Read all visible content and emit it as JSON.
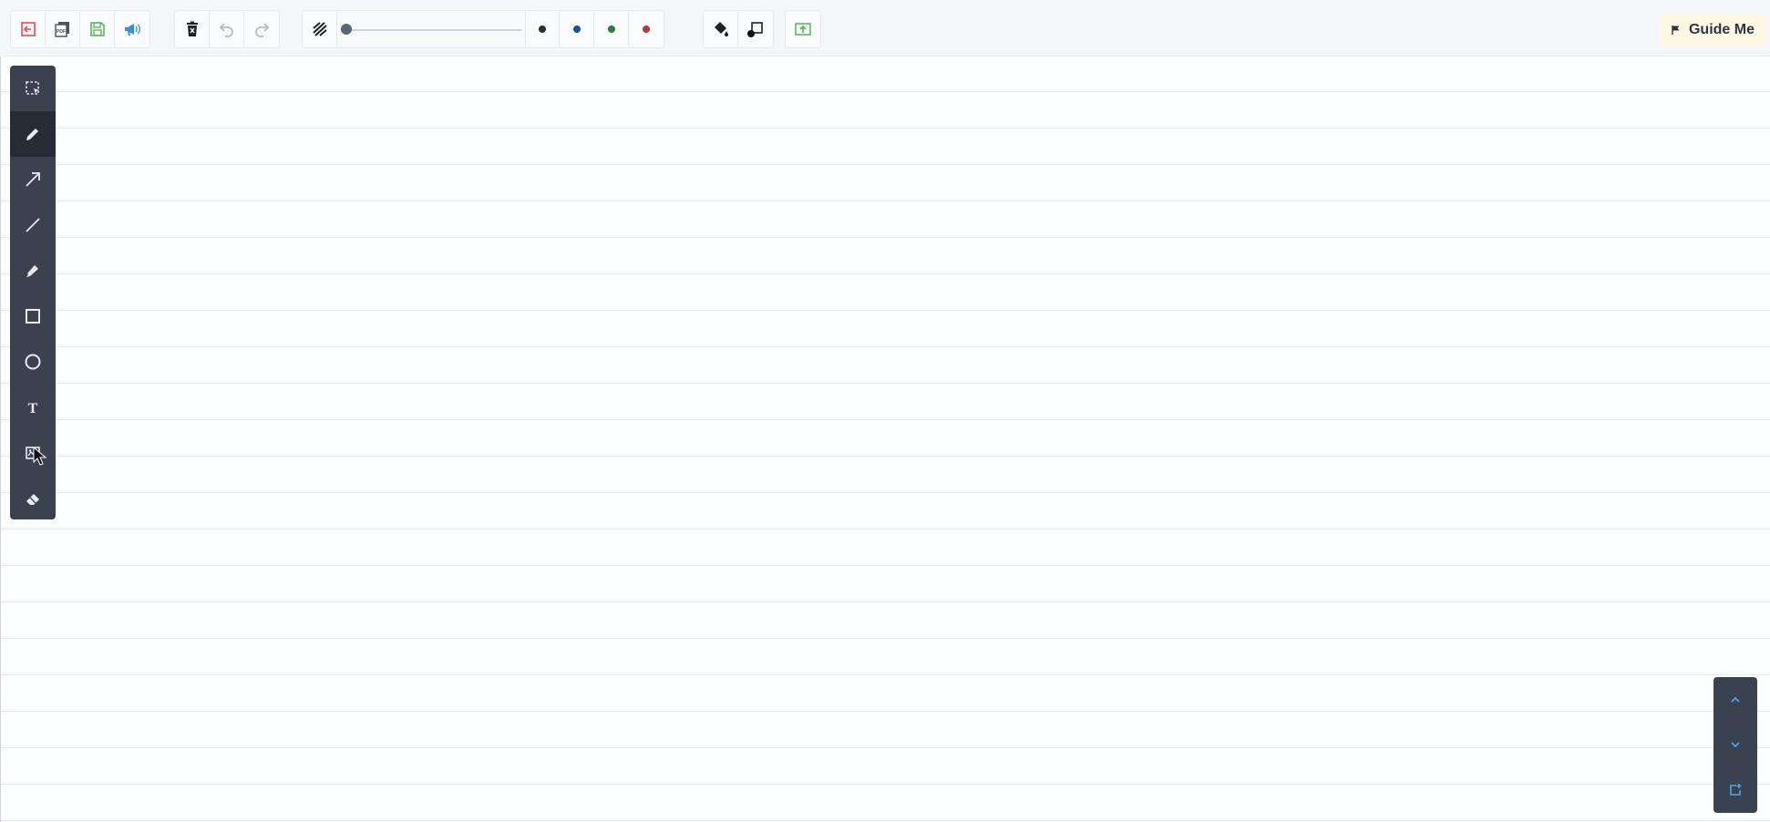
{
  "colors": {
    "toolbar_bg": "#f4f6f9",
    "sidebar_bg": "#3a4250",
    "sidebar_active": "#262c36",
    "accent_red": "#d9534f",
    "accent_green": "#5cb85c",
    "accent_blue": "#3b8fd9",
    "guide_bg": "#fdf8e4"
  },
  "toolbar": {
    "file_group": [
      "exit-icon",
      "pdf-icon",
      "save-icon",
      "megaphone-icon"
    ],
    "edit_group": [
      "delete-icon",
      "undo-icon",
      "redo-icon"
    ],
    "stroke_width_value": 0,
    "pen_colors": [
      {
        "name": "black",
        "hex": "#2d2d2d"
      },
      {
        "name": "blue",
        "hex": "#1f4f96"
      },
      {
        "name": "green",
        "hex": "#2e7d3c"
      },
      {
        "name": "red",
        "hex": "#b23a3a"
      }
    ],
    "fill_group": [
      "fill-bucket-icon",
      "shape-fill-icon"
    ],
    "upload_icon": "upload-icon",
    "guide_label": "Guide Me"
  },
  "sidebar": {
    "tools": [
      {
        "name": "select",
        "icon": "select-icon",
        "active": false
      },
      {
        "name": "pen",
        "icon": "pen-icon",
        "active": true
      },
      {
        "name": "arrow",
        "icon": "arrow-icon",
        "active": false
      },
      {
        "name": "line",
        "icon": "line-icon",
        "active": false
      },
      {
        "name": "highlighter",
        "icon": "highlighter-icon",
        "active": false
      },
      {
        "name": "rectangle",
        "icon": "rectangle-icon",
        "active": false
      },
      {
        "name": "circle",
        "icon": "circle-icon",
        "active": false
      },
      {
        "name": "text",
        "icon": "text-icon",
        "active": false
      },
      {
        "name": "image",
        "icon": "image-icon",
        "active": false
      },
      {
        "name": "eraser",
        "icon": "eraser-icon",
        "active": false
      }
    ]
  },
  "pager": [
    "page-up-icon",
    "page-down-icon",
    "add-page-icon"
  ]
}
